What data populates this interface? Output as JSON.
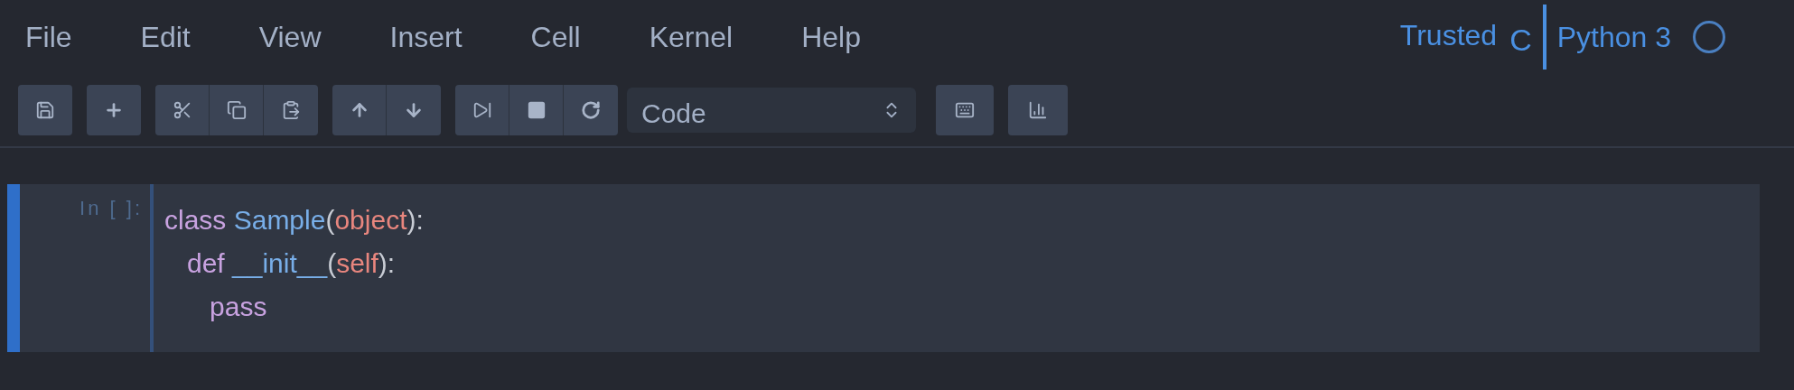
{
  "menu": [
    "File",
    "Edit",
    "View",
    "Insert",
    "Cell",
    "Kernel",
    "Help"
  ],
  "status": {
    "trusted": "Trusted",
    "mode": "C",
    "kernel": "Python 3",
    "busy": false
  },
  "cell_type": "Code",
  "cell": {
    "selected": true,
    "prompt": "In [ ]:",
    "lines": [
      [
        {
          "text": "class ",
          "kind": "keyword"
        },
        {
          "text": "Sample",
          "kind": "name"
        },
        {
          "text": "(",
          "kind": "plain"
        },
        {
          "text": "object",
          "kind": "builtin"
        },
        {
          "text": "):",
          "kind": "plain"
        }
      ],
      [
        {
          "text": "   def ",
          "kind": "keyword"
        },
        {
          "text": "__init__",
          "kind": "name"
        },
        {
          "text": "(",
          "kind": "plain"
        },
        {
          "text": "self",
          "kind": "builtin"
        },
        {
          "text": "):",
          "kind": "plain"
        }
      ],
      [
        {
          "text": "      pass",
          "kind": "keyword"
        }
      ]
    ]
  }
}
